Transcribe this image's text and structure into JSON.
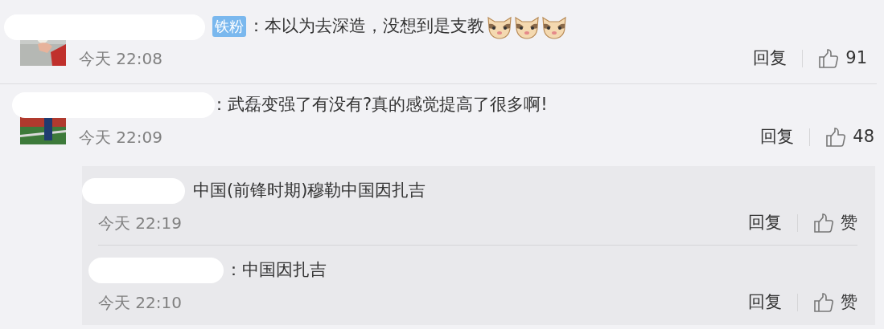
{
  "comments": [
    {
      "badge": "铁粉",
      "text": "：本以为去深造，没想到是支教",
      "time": "今天 22:08",
      "reply_label": "回复",
      "like_label": "91"
    },
    {
      "text": "：武磊变强了有没有?真的感觉提高了很多啊!",
      "time": "今天 22:09",
      "reply_label": "回复",
      "like_label": "48"
    }
  ],
  "replies": [
    {
      "text": "中国(前锋时期)穆勒中国因扎吉",
      "time": "今天 22:19",
      "reply_label": "回复",
      "like_label": "赞"
    },
    {
      "text": "：中国因扎吉",
      "time": "今天 22:10",
      "reply_label": "回复",
      "like_label": "赞"
    }
  ]
}
